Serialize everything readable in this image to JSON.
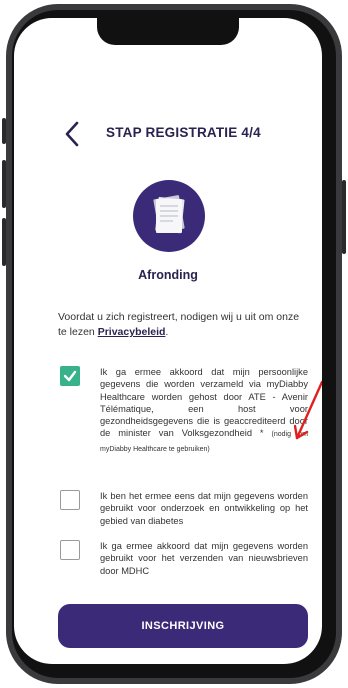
{
  "header": {
    "title": "STAP REGISTRATIE 4/4"
  },
  "step": {
    "label": "Afronding",
    "icon": "documents-icon"
  },
  "intro": {
    "text": "Voordat u zich registreert, nodigen wij u uit om onze te lezen ",
    "link": "Privacybeleid",
    "end": "."
  },
  "consents": [
    {
      "checked": true,
      "text": "Ik ga ermee akkoord dat mijn persoonlijke gegevens die worden verzameld via myDiabby Healthcare worden gehost door ATE - Avenir Télématique, een host voor gezondheidsgegevens die is geaccrediteerd door de minister van Volksgezondheid *",
      "note": "(nodig om myDiabby Healthcare te gebruiken)"
    },
    {
      "checked": false,
      "text": "Ik ben het ermee eens dat mijn gegevens worden gebruikt voor onderzoek en ontwikkeling op het gebied van diabetes"
    },
    {
      "checked": false,
      "text": "Ik ga ermee akkoord dat mijn gegevens worden gebruikt voor het verzenden van nieuwsbrieven door MDHC"
    }
  ],
  "cta": {
    "label": "INSCHRIJVING"
  },
  "colors": {
    "primary": "#3b2a78",
    "check": "#38b28a",
    "annotation": "#e02020"
  }
}
